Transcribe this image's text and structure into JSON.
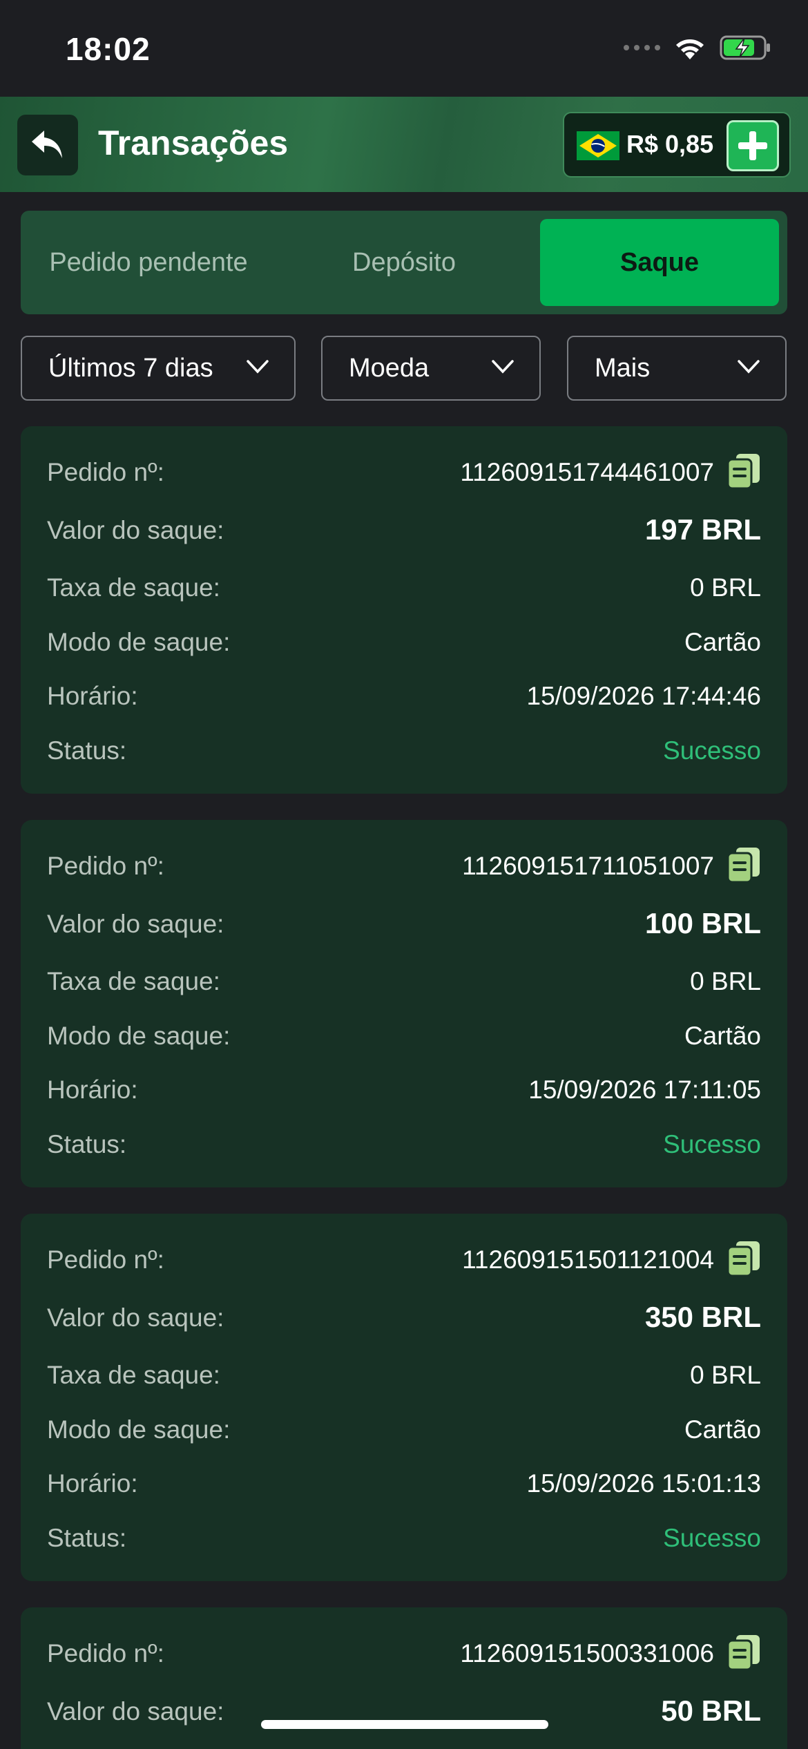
{
  "status_bar": {
    "time": "18:02"
  },
  "header": {
    "title": "Transações",
    "balance": "R$ 0,85"
  },
  "tabs": [
    {
      "label": "Pedido pendente",
      "active": false
    },
    {
      "label": "Depósito",
      "active": false
    },
    {
      "label": "Saque",
      "active": true
    }
  ],
  "filters": {
    "period": "Últimos 7 dias",
    "currency": "Moeda",
    "more": "Mais"
  },
  "labels": {
    "order": "Pedido nº:",
    "amount": "Valor do saque:",
    "fee": "Taxa de saque:",
    "mode": "Modo de saque:",
    "time": "Horário:",
    "status": "Status:"
  },
  "transactions": [
    {
      "order": "112609151744461007",
      "amount": "197 BRL",
      "fee": "0 BRL",
      "mode": "Cartão",
      "time": "15/09/2026 17:44:46",
      "status": "Sucesso"
    },
    {
      "order": "112609151711051007",
      "amount": "100 BRL",
      "fee": "0 BRL",
      "mode": "Cartão",
      "time": "15/09/2026 17:11:05",
      "status": "Sucesso"
    },
    {
      "order": "112609151501121004",
      "amount": "350 BRL",
      "fee": "0 BRL",
      "mode": "Cartão",
      "time": "15/09/2026 15:01:13",
      "status": "Sucesso"
    },
    {
      "order": "112609151500331006",
      "amount": "50 BRL"
    }
  ],
  "colors": {
    "accent": "#00b254",
    "success": "#2fbf79",
    "card_bg": "#173125",
    "page_bg": "#1d1e22"
  }
}
